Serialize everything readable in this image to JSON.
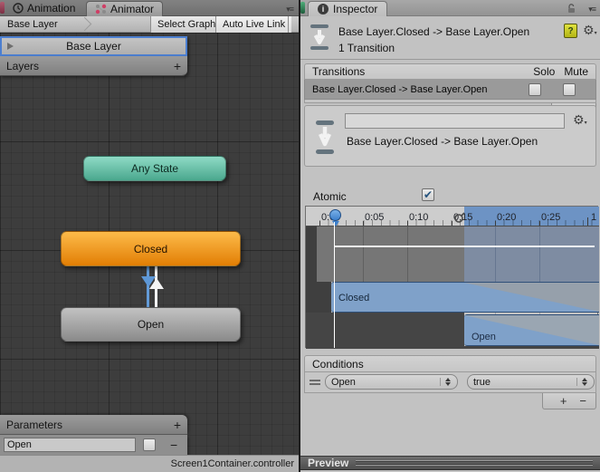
{
  "animator": {
    "tab_animation": "Animation",
    "tab_animator": "Animator",
    "menu_glyph": "▾≡",
    "breadcrumb": "Base Layer",
    "btn_select_graph": "Select Graph",
    "btn_auto_live_link": "Auto Live Link",
    "layer_row": "Base Layer",
    "layers_header": "Layers",
    "layers_add": "+",
    "node_any_state": "Any State",
    "node_closed": "Closed",
    "node_open": "Open",
    "params_header": "Parameters",
    "params_add": "+",
    "param_value": "Open",
    "param_remove": "−",
    "status": "Screen1Container.controller"
  },
  "inspector": {
    "tab": "Inspector",
    "menu_glyph": "▾≡",
    "title": "Base Layer.Closed -> Base Layer.Open",
    "subtitle": "1 Transition",
    "transitions_header": "Transitions",
    "solo": "Solo",
    "mute": "Mute",
    "transition_row": "Base Layer.Closed -> Base Layer.Open",
    "transitions_remove": "−",
    "detail_name": "",
    "detail_label": "Base Layer.Closed -> Base Layer.Open",
    "atomic_label": "Atomic",
    "timeline": {
      "ticks": [
        "0:00",
        "0:05",
        "0:10",
        "0:15",
        "0:20",
        "0:25"
      ],
      "end_label": "1",
      "closed": "Closed",
      "open": "Open"
    },
    "conditions_header": "Conditions",
    "condition_param": "Open",
    "condition_value": "true",
    "conditions_add": "+",
    "conditions_remove": "−",
    "preview": "Preview"
  },
  "colors": {
    "selection_blue": "#4c7fd0",
    "node_orange": "#f49c20",
    "node_teal": "#5fc0a7",
    "timeline_blue": "#6d93c4",
    "bar_blue": "#7fa1c9"
  }
}
